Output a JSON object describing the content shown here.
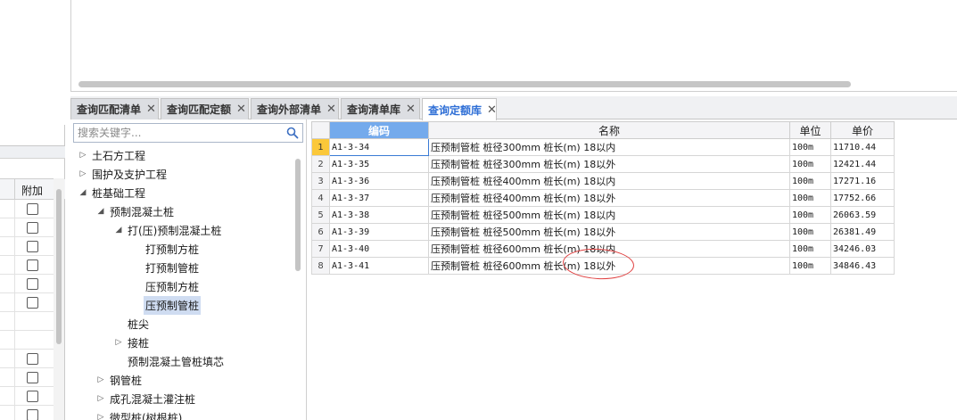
{
  "tabs": [
    {
      "label": "查询匹配清单",
      "close": "✕",
      "active": false
    },
    {
      "label": "查询匹配定额",
      "close": "✕",
      "active": false
    },
    {
      "label": "查询外部清单",
      "close": "✕",
      "active": false
    },
    {
      "label": "查询清单库",
      "close": "✕",
      "active": false
    },
    {
      "label": "查询定额库",
      "close": "✕",
      "active": true
    }
  ],
  "left_panel": {
    "attach_header": "附加"
  },
  "search": {
    "placeholder": "搜索关键字..."
  },
  "tree": [
    {
      "label": "土石方工程",
      "arrow": "▷",
      "level": 0
    },
    {
      "label": "围护及支护工程",
      "arrow": "▷",
      "level": 0
    },
    {
      "label": "桩基础工程",
      "arrow": "◢",
      "level": 0
    },
    {
      "label": "预制混凝土桩",
      "arrow": "◢",
      "level": 1
    },
    {
      "label": "打(压)预制混凝土桩",
      "arrow": "◢",
      "level": 2
    },
    {
      "label": "打预制方桩",
      "arrow": "",
      "level": 3
    },
    {
      "label": "打预制管桩",
      "arrow": "",
      "level": 3
    },
    {
      "label": "压预制方桩",
      "arrow": "",
      "level": 3
    },
    {
      "label": "压预制管桩",
      "arrow": "",
      "level": 3,
      "selected": true
    },
    {
      "label": "桩尖",
      "arrow": "",
      "level": 2
    },
    {
      "label": "接桩",
      "arrow": "▷",
      "level": 2
    },
    {
      "label": "预制混凝土管桩填芯",
      "arrow": "",
      "level": 2
    },
    {
      "label": "钢管桩",
      "arrow": "▷",
      "level": 1
    },
    {
      "label": "成孔混凝土灌注桩",
      "arrow": "▷",
      "level": 1
    },
    {
      "label": "微型桩(树根桩)",
      "arrow": "▷",
      "level": 1
    }
  ],
  "table": {
    "headers": {
      "code": "编码",
      "name": "名称",
      "unit": "单位",
      "price": "单价"
    },
    "rows": [
      {
        "num": "1",
        "code": "A1-3-34",
        "name": "压预制管桩 桩径300mm 桩长(m) 18以内",
        "unit": "100m",
        "price": "11710.44"
      },
      {
        "num": "2",
        "code": "A1-3-35",
        "name": "压预制管桩 桩径300mm 桩长(m) 18以外",
        "unit": "100m",
        "price": "12421.44"
      },
      {
        "num": "3",
        "code": "A1-3-36",
        "name": "压预制管桩 桩径400mm 桩长(m) 18以内",
        "unit": "100m",
        "price": "17271.16"
      },
      {
        "num": "4",
        "code": "A1-3-37",
        "name": "压预制管桩 桩径400mm 桩长(m) 18以外",
        "unit": "100m",
        "price": "17752.66"
      },
      {
        "num": "5",
        "code": "A1-3-38",
        "name": "压预制管桩 桩径500mm 桩长(m) 18以内",
        "unit": "100m",
        "price": "26063.59"
      },
      {
        "num": "6",
        "code": "A1-3-39",
        "name": "压预制管桩 桩径500mm 桩长(m) 18以外",
        "unit": "100m",
        "price": "26381.49"
      },
      {
        "num": "7",
        "code": "A1-3-40",
        "name": "压预制管桩 桩径600mm 桩长(m) 18以内",
        "unit": "100m",
        "price": "34246.03"
      },
      {
        "num": "8",
        "code": "A1-3-41",
        "name": "压预制管桩 桩径600mm 桩长(m) 18以外",
        "unit": "100m",
        "price": "34846.43"
      }
    ]
  },
  "colors": {
    "sorted_header": "#74aaec",
    "active_tab_text": "#2f6fd6",
    "selected_tree_item": "#cfdcf1",
    "current_row_marker": "#fbc83a",
    "annotation": "#e04040"
  }
}
